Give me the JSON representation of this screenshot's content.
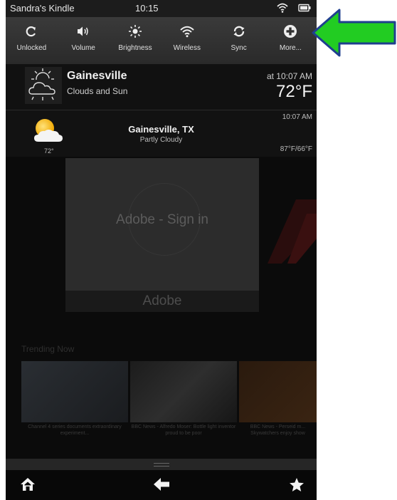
{
  "status_bar": {
    "owner": "Sandra's Kindle",
    "time": "10:15",
    "icons": [
      "wifi-icon",
      "battery-icon"
    ]
  },
  "quick_settings": [
    {
      "label": "Unlocked",
      "icon": "rotation-unlocked-icon"
    },
    {
      "label": "Volume",
      "icon": "volume-icon"
    },
    {
      "label": "Brightness",
      "icon": "brightness-icon"
    },
    {
      "label": "Wireless",
      "icon": "wireless-icon"
    },
    {
      "label": "Sync",
      "icon": "sync-icon"
    },
    {
      "label": "More...",
      "icon": "plus-icon"
    }
  ],
  "weather_primary": {
    "city": "Gainesville",
    "condition": "Clouds and Sun",
    "updated": "at 10:07 AM",
    "temp": "72°F"
  },
  "weather_secondary": {
    "city": "Gainesville, TX",
    "condition": "Partly Cloudy",
    "time": "10:07 AM",
    "icon_temp": "72°",
    "hi_lo": "87°F/66°F"
  },
  "background": {
    "card_title": "Adobe - Sign in",
    "card_caption": "Adobe",
    "trending_label": "Trending Now",
    "thumbs": [
      {
        "caption": "Channel 4 series documents extraordinary experiment..."
      },
      {
        "caption": "BBC News - Alfredo Moser: Bottle light inventor proud to be poor"
      },
      {
        "caption": "BBC News - Perseid m... Skywatchers enjoy show"
      }
    ]
  },
  "nav": {
    "icons": [
      "home-icon",
      "back-icon",
      "favorites-icon"
    ]
  },
  "colors": {
    "annotation_arrow": "#22cc22",
    "annotation_outline": "#1f3f8f"
  }
}
